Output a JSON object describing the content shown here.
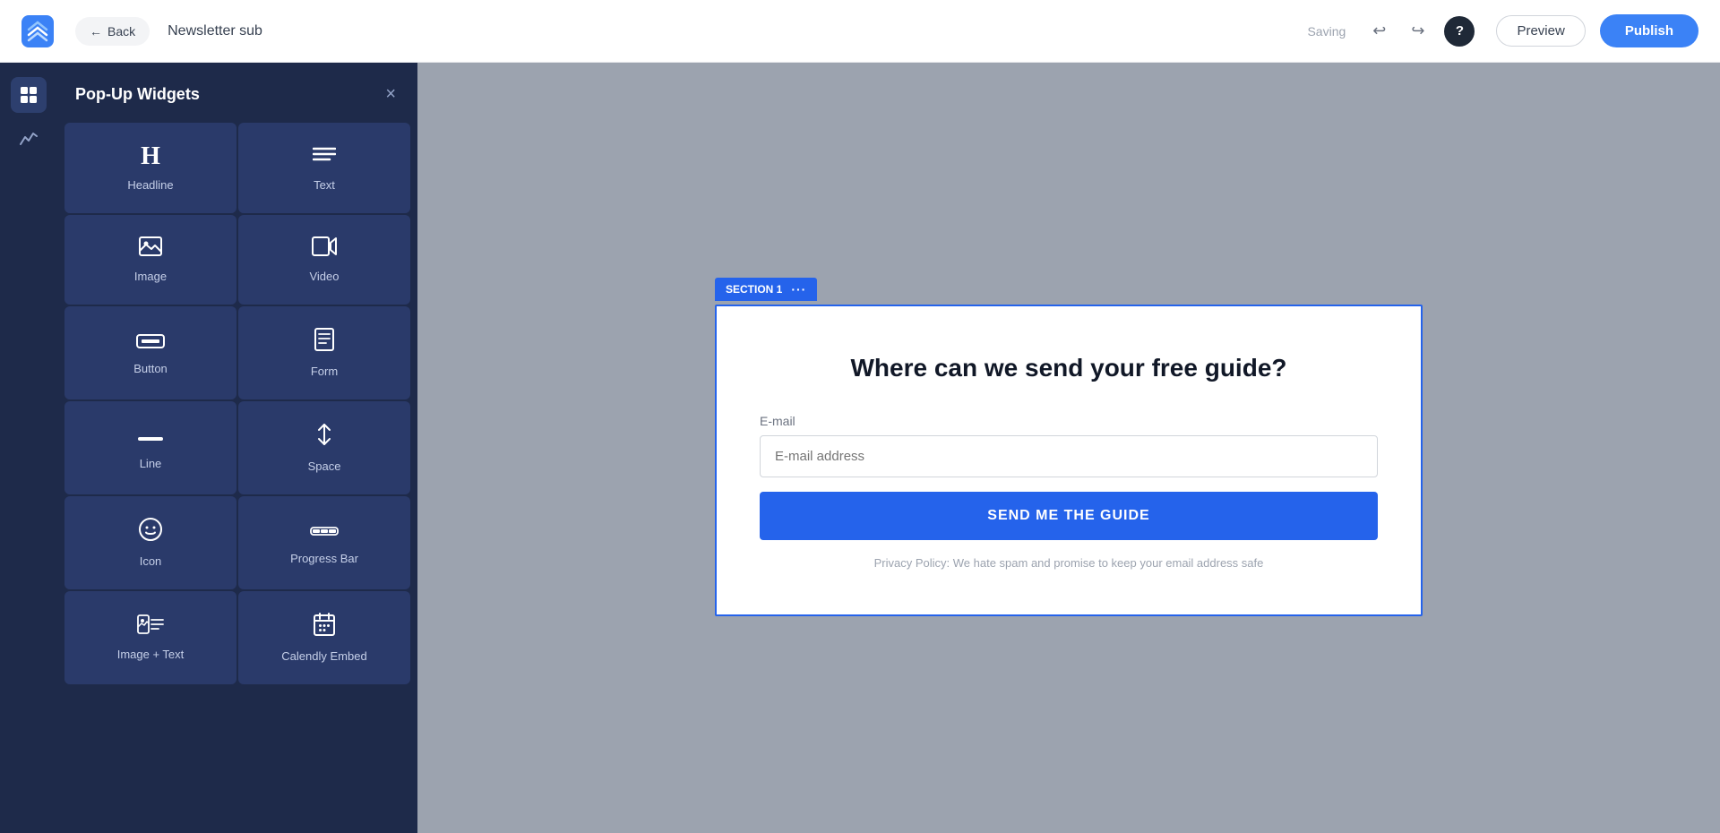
{
  "topbar": {
    "back_label": "Back",
    "page_title": "Newsletter sub",
    "saving_label": "Saving",
    "undo_label": "↩",
    "redo_label": "↪",
    "help_label": "?",
    "preview_label": "Preview",
    "publish_label": "Publish"
  },
  "widget_panel": {
    "title": "Pop-Up Widgets",
    "close_label": "×",
    "widgets": [
      {
        "id": "headline",
        "label": "Headline",
        "icon": "H"
      },
      {
        "id": "text",
        "label": "Text",
        "icon": "≡"
      },
      {
        "id": "image",
        "label": "Image",
        "icon": "🖼"
      },
      {
        "id": "video",
        "label": "Video",
        "icon": "🎥"
      },
      {
        "id": "button",
        "label": "Button",
        "icon": "▬"
      },
      {
        "id": "form",
        "label": "Form",
        "icon": "📋"
      },
      {
        "id": "line",
        "label": "Line",
        "icon": "—"
      },
      {
        "id": "space",
        "label": "Space",
        "icon": "↑↓"
      },
      {
        "id": "icon",
        "label": "Icon",
        "icon": "☺"
      },
      {
        "id": "progress-bar",
        "label": "Progress Bar",
        "icon": "▤"
      },
      {
        "id": "image-text",
        "label": "Image + Text",
        "icon": "🖼≡"
      },
      {
        "id": "calendly",
        "label": "Calendly Embed",
        "icon": "📅"
      }
    ]
  },
  "popup": {
    "section_label": "SECTION 1",
    "section_dots": "···",
    "heading": "Where can we send your free guide?",
    "email_label": "E-mail",
    "email_placeholder": "E-mail address",
    "submit_label": "SEND ME THE GUIDE",
    "privacy_text": "Privacy Policy: We hate spam and promise to keep your email address safe"
  },
  "colors": {
    "accent_blue": "#2563eb",
    "sidebar_bg": "#1e2a4a",
    "widget_bg": "#2a3a6a",
    "canvas_bg": "#9ca3af"
  }
}
